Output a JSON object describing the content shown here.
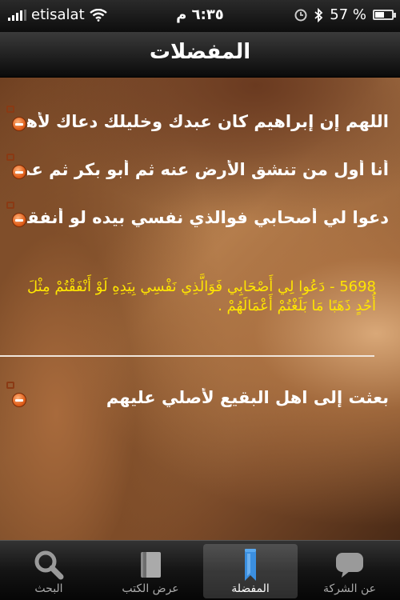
{
  "status_bar": {
    "carrier": "etisalat",
    "time": "٦:٣٥ م",
    "battery_percent_label": "57 %",
    "battery_level": 0.57
  },
  "nav": {
    "title": "المفضلات"
  },
  "favorites": [
    {
      "text": "اللهم إن إبراهيم كان عبدك وخليلك دعاك لأهل مك.."
    },
    {
      "text": "أنا أول من تنشق الأرض عنه ثم أبو بكر ثم عمر..."
    },
    {
      "text": "دعوا لي أصحابي فوالذي نفسي بيده لو أنفقتم.."
    },
    {
      "text": "بعثت إلى اهل البقيع لأصلي عليهم"
    }
  ],
  "detail": {
    "text": "5698 - دَعُوا لِي أَصْحَابِي فَوَالَّذِي نَفْسِي بِيَدِهِ لَوْ أَنْفَقْتُمْ مِثْلَ أُحُدٍ ذَهَبًا مَا بَلَغْتُمْ أَعْمَالَهُمْ ."
  },
  "tabs": [
    {
      "label": "البحث",
      "icon": "search-icon"
    },
    {
      "label": "عرض الكتب",
      "icon": "books-icon"
    },
    {
      "label": "المفضلة",
      "icon": "bookmark-icon",
      "selected": true
    },
    {
      "label": "عن الشركة",
      "icon": "chat-bubble-icon"
    }
  ],
  "colors": {
    "detail_text": "#ffe600",
    "delete_button": "#e0601c",
    "bookmark_blue": "#3b8fe0"
  }
}
